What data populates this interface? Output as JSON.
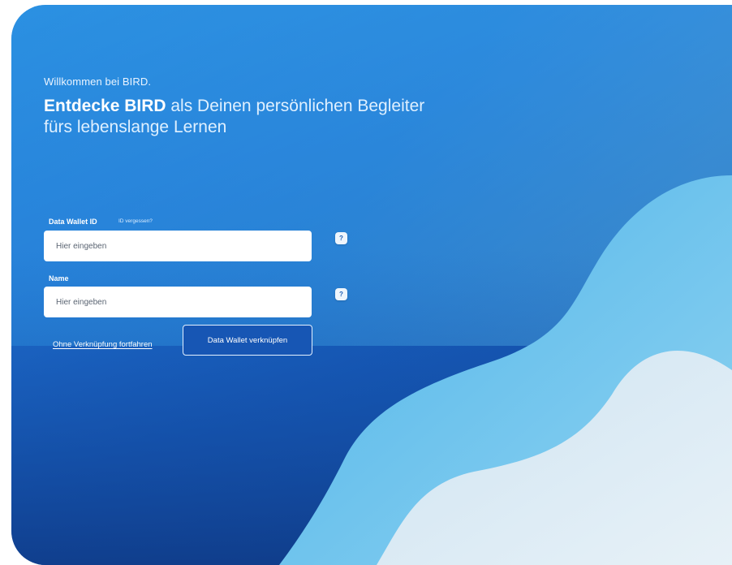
{
  "intro": {
    "welcome": "Willkommen bei BIRD.",
    "headline_bold": "Entdecke BIRD",
    "headline_rest": " als Deinen persönlichen Begleiter fürs lebenslange Lernen"
  },
  "form": {
    "wallet_id": {
      "label": "Data Wallet ID",
      "forgot_link": "ID vergessen?",
      "placeholder": "Hier eingeben",
      "help": "?"
    },
    "name": {
      "label": "Name",
      "placeholder": "Hier eingeben",
      "help": "?"
    }
  },
  "actions": {
    "skip_link": "Ohne Verknüpfung fortfahren",
    "connect_button": "Data Wallet verknüpfen"
  },
  "colors": {
    "background_dark": "#1556b3",
    "wave_mid": "#5fc1ec",
    "wave_light": "#d9eaf4",
    "button": "#1756b4"
  },
  "icons": {
    "help": "question-mark-icon"
  }
}
